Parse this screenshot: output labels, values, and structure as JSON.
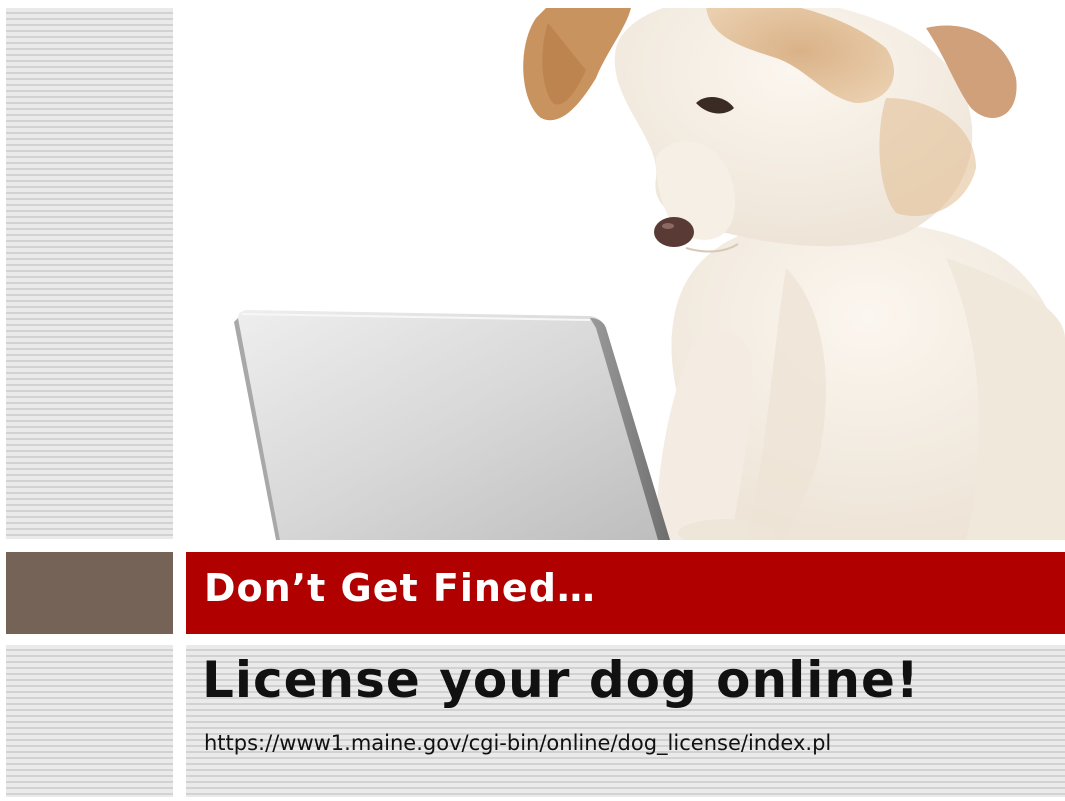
{
  "slide": {
    "title": "Don’t Get Fined…",
    "subtitle": "License your dog online!",
    "url": "https://www1.maine.gov/cgi-bin/online/dog_license/index.pl"
  },
  "colors": {
    "title_bar": "#b00000",
    "accent_block": "#766357",
    "stripe_light": "#eaeaea",
    "stripe_dark": "#d2d2d2"
  },
  "image": {
    "description_icon": "dog-with-laptop-photo"
  }
}
